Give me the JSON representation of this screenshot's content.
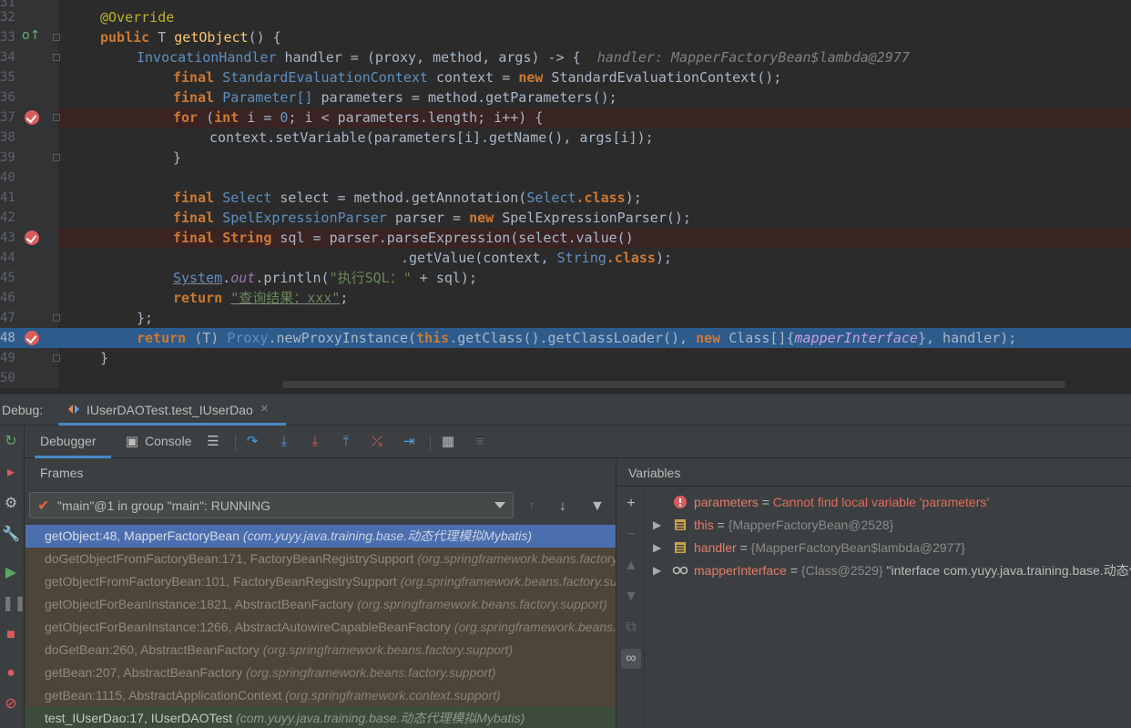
{
  "editor": {
    "lines": [
      {
        "num": "31",
        "kind": "normal"
      },
      {
        "num": "32",
        "kind": "normal"
      },
      {
        "num": "33",
        "kind": "normal"
      },
      {
        "num": "34",
        "kind": "normal"
      },
      {
        "num": "35",
        "kind": "normal"
      },
      {
        "num": "36",
        "kind": "normal"
      },
      {
        "num": "37",
        "kind": "breakpoint"
      },
      {
        "num": "38",
        "kind": "normal"
      },
      {
        "num": "39",
        "kind": "normal"
      },
      {
        "num": "40",
        "kind": "normal"
      },
      {
        "num": "41",
        "kind": "normal"
      },
      {
        "num": "42",
        "kind": "normal"
      },
      {
        "num": "43",
        "kind": "breakpoint"
      },
      {
        "num": "44",
        "kind": "normal"
      },
      {
        "num": "45",
        "kind": "normal"
      },
      {
        "num": "46",
        "kind": "normal"
      },
      {
        "num": "47",
        "kind": "normal"
      },
      {
        "num": "48",
        "kind": "execution-point"
      },
      {
        "num": "49",
        "kind": "normal"
      },
      {
        "num": "50",
        "kind": "normal"
      }
    ],
    "code": {
      "l32_annotation": "@Override",
      "l33_kw": "public",
      "l33_t": " T ",
      "l33_fn": "getObject",
      "l33_rest": "() {",
      "l34_type": "InvocationHandler",
      "l34_rest1": " handler = ",
      "l34_lambda": "(proxy, method, args) -> {",
      "l34_hint": "handler: MapperFactoryBean$lambda@2977",
      "l35_kw": "final",
      "l35_type": "StandardEvaluationContext",
      "l35_mid": " context = ",
      "l35_new": "new",
      "l35_rest": " StandardEvaluationContext();",
      "l36_kw": "final",
      "l36_type": "Parameter[]",
      "l36_mid": " parameters = method.getParameters();",
      "l37_kw": "for",
      "l37_p1": " (",
      "l37_int": "int",
      "l37_p2": " i = ",
      "l37_zero": "0",
      "l37_p3": "; i < parameters.length; i++) {",
      "l38": "context.setVariable(parameters[i].getName(), args[i]);",
      "l39": "}",
      "l41_kw": "final",
      "l41_type": "Select",
      "l41_mid": " select = method.getAnnotation(",
      "l41_sel": "Select",
      "l41_cls": ".class",
      "l41_end": ");",
      "l42_kw": "final",
      "l42_type": "SpelExpressionParser",
      "l42_mid": " parser = ",
      "l42_new": "new",
      "l42_rest": " SpelExpressionParser();",
      "l43_kw": "final",
      "l43_type": "String",
      "l43_rest": " sql = parser.parseExpression(select.value()",
      "l44_a": ".getValue(context, ",
      "l44_str": "String",
      "l44_cls": ".class",
      "l44_end": ");",
      "l45_sys": "System",
      "l45_dot": ".",
      "l45_out": "out",
      "l45_mid": ".println(",
      "l45_str": "\"执行SQL：\"",
      "l45_end": " + sql);",
      "l46_kw": "return",
      "l46_str": "\"查询结果：xxx\"",
      "l46_end": ";",
      "l47": "};",
      "l48_kw": "return",
      "l48_cast": " (T) ",
      "l48_proxy": "Proxy",
      "l48_mid": ".newProxyInstance(",
      "l48_this": "this",
      "l48_mid2": ".getClass().getClassLoader(), ",
      "l48_new": "new",
      "l48_cls": " Class[]{",
      "l48_field": "mapperInterface",
      "l48_end": "}, handler);",
      "l49": "}"
    }
  },
  "debug": {
    "title_label": "Debug:",
    "tab_label": "IUserDAOTest.test_IUserDao",
    "tab_close": "×",
    "subtabs": {
      "debugger": "Debugger",
      "console": "Console"
    },
    "frames_header": "Frames",
    "thread_text": "\"main\"@1 in group \"main\": RUNNING",
    "frames": [
      {
        "name": "getObject:48, MapperFactoryBean",
        "pkg": "(com.yuyy.java.training.base.动态代理模拟Mybatis)",
        "kind": "sel"
      },
      {
        "name": "doGetObjectFromFactoryBean:171, FactoryBeanRegistrySupport",
        "pkg": "(org.springframework.beans.factory.support)",
        "kind": "lib"
      },
      {
        "name": "getObjectFromFactoryBean:101, FactoryBeanRegistrySupport",
        "pkg": "(org.springframework.beans.factory.support)",
        "kind": "lib"
      },
      {
        "name": "getObjectForBeanInstance:1821, AbstractBeanFactory",
        "pkg": "(org.springframework.beans.factory.support)",
        "kind": "lib"
      },
      {
        "name": "getObjectForBeanInstance:1266, AbstractAutowireCapableBeanFactory",
        "pkg": "(org.springframework.beans.factory.support)",
        "kind": "lib"
      },
      {
        "name": "doGetBean:260, AbstractBeanFactory",
        "pkg": "(org.springframework.beans.factory.support)",
        "kind": "lib"
      },
      {
        "name": "getBean:207, AbstractBeanFactory",
        "pkg": "(org.springframework.beans.factory.support)",
        "kind": "lib"
      },
      {
        "name": "getBean:1115, AbstractApplicationContext",
        "pkg": "(org.springframework.context.support)",
        "kind": "lib"
      },
      {
        "name": "test_IUserDao:17, IUserDAOTest",
        "pkg": "(com.yuyy.java.training.base.动态代理模拟Mybatis)",
        "kind": "user"
      }
    ],
    "variables_header": "Variables",
    "variables": [
      {
        "name": "parameters",
        "eq": " = ",
        "type": "",
        "value": "Cannot find local variable 'parameters'",
        "kind": "error"
      },
      {
        "name": "this",
        "eq": " = ",
        "type": "{MapperFactoryBean@2528}",
        "value": "",
        "kind": "object"
      },
      {
        "name": "handler",
        "eq": " = ",
        "type": "{MapperFactoryBean$lambda@2977}",
        "value": "",
        "kind": "object"
      },
      {
        "name": "mapperInterface",
        "eq": " = ",
        "type": "{Class@2529}",
        "value": " \"interface com.yuyy.java.training.base.动态代理模拟Mybatis.IUserDao\"",
        "kind": "watch"
      }
    ]
  },
  "colors": {
    "editor_bg": "#2b2b2b",
    "exec_line": "#2d5b8c",
    "breakpoint": "#db5c5c",
    "selected_frame": "#4b6eaf",
    "library_frame": "#4d4539",
    "user_frame": "#3d4b3b"
  }
}
